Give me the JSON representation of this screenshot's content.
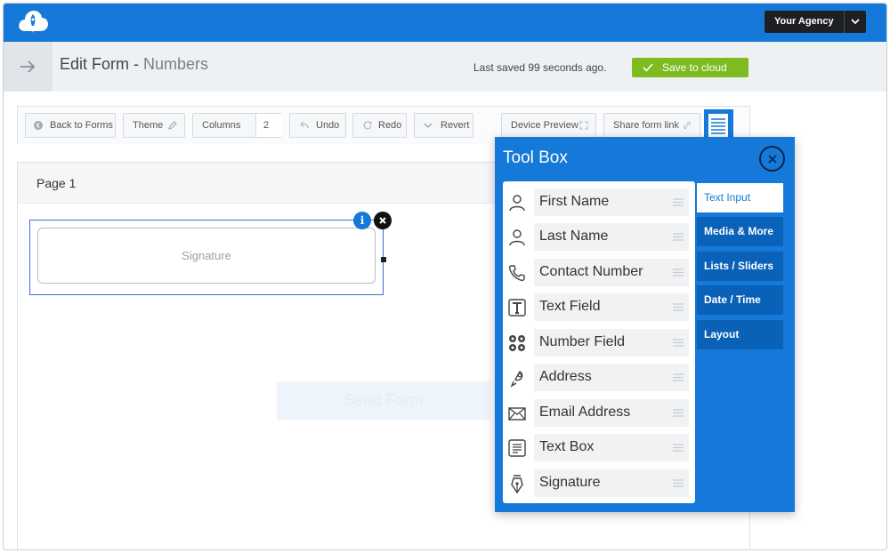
{
  "topbar": {
    "agency_label": "Your Agency"
  },
  "header": {
    "title": "Edit Form - ",
    "subtitle": "Numbers",
    "saved_text": "Last saved 99 seconds ago.",
    "save_label": "Save to cloud"
  },
  "toolbar": {
    "back_label": "Back to Forms",
    "theme_label": "Theme",
    "columns_label": "Columns",
    "columns_value": "2",
    "undo_label": "Undo",
    "redo_label": "Redo",
    "revert_label": "Revert",
    "device_label": "Device Preview",
    "share_label": "Share form link"
  },
  "canvas": {
    "page_label": "Page 1",
    "signature_label": "Signature",
    "send_label": "Send Form",
    "info_glyph": "i"
  },
  "toolbox": {
    "title": "Tool Box",
    "fields": [
      {
        "label": "First Name",
        "icon": "person-icon"
      },
      {
        "label": "Last Name",
        "icon": "person-icon"
      },
      {
        "label": "Contact Number",
        "icon": "phone-icon"
      },
      {
        "label": "Text Field",
        "icon": "text-field-icon"
      },
      {
        "label": "Number Field",
        "icon": "number-field-icon"
      },
      {
        "label": "Address",
        "icon": "map-pin-icon"
      },
      {
        "label": "Email Address",
        "icon": "envelope-icon"
      },
      {
        "label": "Text Box",
        "icon": "text-box-icon"
      },
      {
        "label": "Signature",
        "icon": "pen-nib-icon"
      }
    ],
    "categories": [
      {
        "label": "Text Input",
        "active": true
      },
      {
        "label": "Media & More",
        "active": false
      },
      {
        "label": "Lists / Sliders",
        "active": false
      },
      {
        "label": "Date / Time",
        "active": false
      },
      {
        "label": "Layout",
        "active": false
      }
    ]
  },
  "colors": {
    "brand_blue": "#1479d9",
    "save_green": "#7dbb1f",
    "agency_dark": "#1d1f22"
  }
}
